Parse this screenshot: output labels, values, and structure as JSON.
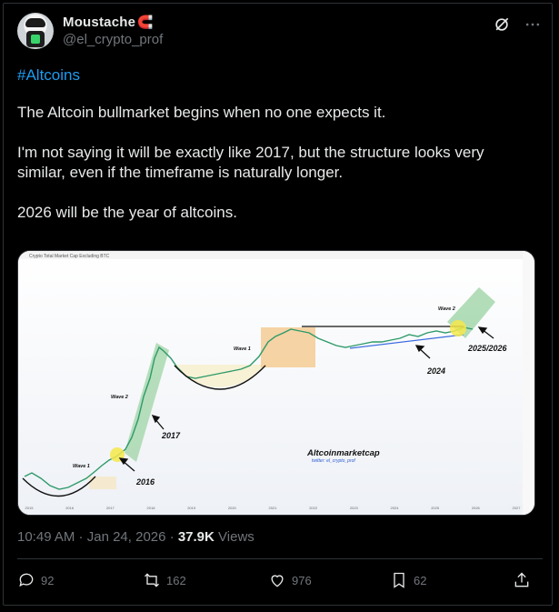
{
  "user": {
    "display_name": "Moustache",
    "badge_icon": "magnet-icon",
    "handle": "@el_crypto_prof"
  },
  "header_icons": [
    "grok-icon",
    "more-icon"
  ],
  "post": {
    "hashtag": "#Altcoins",
    "para1": "The Altcoin bullmarket begins when no one expects it.",
    "para2": "I'm not saying it will be exactly like 2017, but the structure looks very similar, even if the timeframe is naturally longer.",
    "para3": "2026 will be the year of altcoins."
  },
  "chart_data": {
    "type": "line",
    "title": "Crypto Total Market Cap Excluding BTC",
    "watermark": "Altcoinmarketcap",
    "watermark_sub": "twitter: el_crypto_prof",
    "x_labels": [
      "2015",
      "2016",
      "2017",
      "2018",
      "2019",
      "2020",
      "2021",
      "2022",
      "2023",
      "2024",
      "2025",
      "2026",
      "2027"
    ],
    "annotations": {
      "wave1_early": "Wave 1",
      "wave2_early": "Wave 2",
      "wave1_late": "Wave 1",
      "wave2_late": "Wave 2",
      "label_2016": "2016",
      "label_2017": "2017",
      "label_2024": "2024",
      "label_2025_2026": "2025/2026"
    },
    "log_scale": true
  },
  "meta": {
    "time": "10:49 AM",
    "sep": " · ",
    "date": "Jan 24, 2026",
    "views_count": "37.9K",
    "views_label": "Views"
  },
  "actions": {
    "replies": "92",
    "reposts": "162",
    "likes": "976",
    "bookmarks": "62"
  },
  "colors": {
    "background": "#000000",
    "text": "#e7e9ea",
    "muted": "#71767b",
    "link": "#1d9bf0",
    "border": "#2f3336"
  }
}
